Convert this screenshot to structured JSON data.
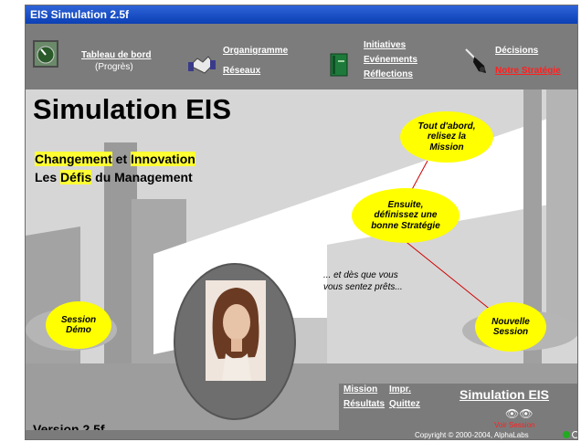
{
  "window": {
    "title": "EIS Simulation 2.5f"
  },
  "toolbar": {
    "tableau_label": "Tableau de bord",
    "tableau_sub": "(Progrès)",
    "organigramme": "Organigramme",
    "reseaux": "Réseaux",
    "initiatives": "Initiatives",
    "evenements": "Evénements",
    "reflections": "Réflections",
    "decisions": "Décisions",
    "strategie": "Notre Stratégie",
    "icons": [
      "gauge-icon",
      "handshake-icon",
      "book-icon",
      "saxophone-icon"
    ]
  },
  "main": {
    "title": "Simulation EIS",
    "subtitle_line1": {
      "part1": "Changement",
      "part2": " et ",
      "part3": "Innovation"
    },
    "subtitle_line2": {
      "part1": "Les ",
      "part2": "Défis",
      "part3": " du Management"
    },
    "bubble_mission": "Tout d'abord, relisez la Mission",
    "bubble_strategy": "Ensuite, définissez une bonne Stratégie",
    "note": "... et dès que vous vous sentez prêts...",
    "session_demo": "Session Démo",
    "nouvelle_session": "Nouvelle Session",
    "version": "Version 2.5f"
  },
  "bottom_panel": {
    "mission": "Mission",
    "impr": "Impr.",
    "resultats": "Résultats",
    "quittez": "Quittez",
    "sim_title": "Simulation EIS",
    "voir_session": "Voir Session"
  },
  "status": {
    "copyright": "Copyright © 2000-2004, AlphaLabs"
  },
  "colors": {
    "highlight": "#ffff33",
    "bubble": "#ffff00",
    "link_red": "#ff2020",
    "title_blue": "#0b3fb4"
  }
}
